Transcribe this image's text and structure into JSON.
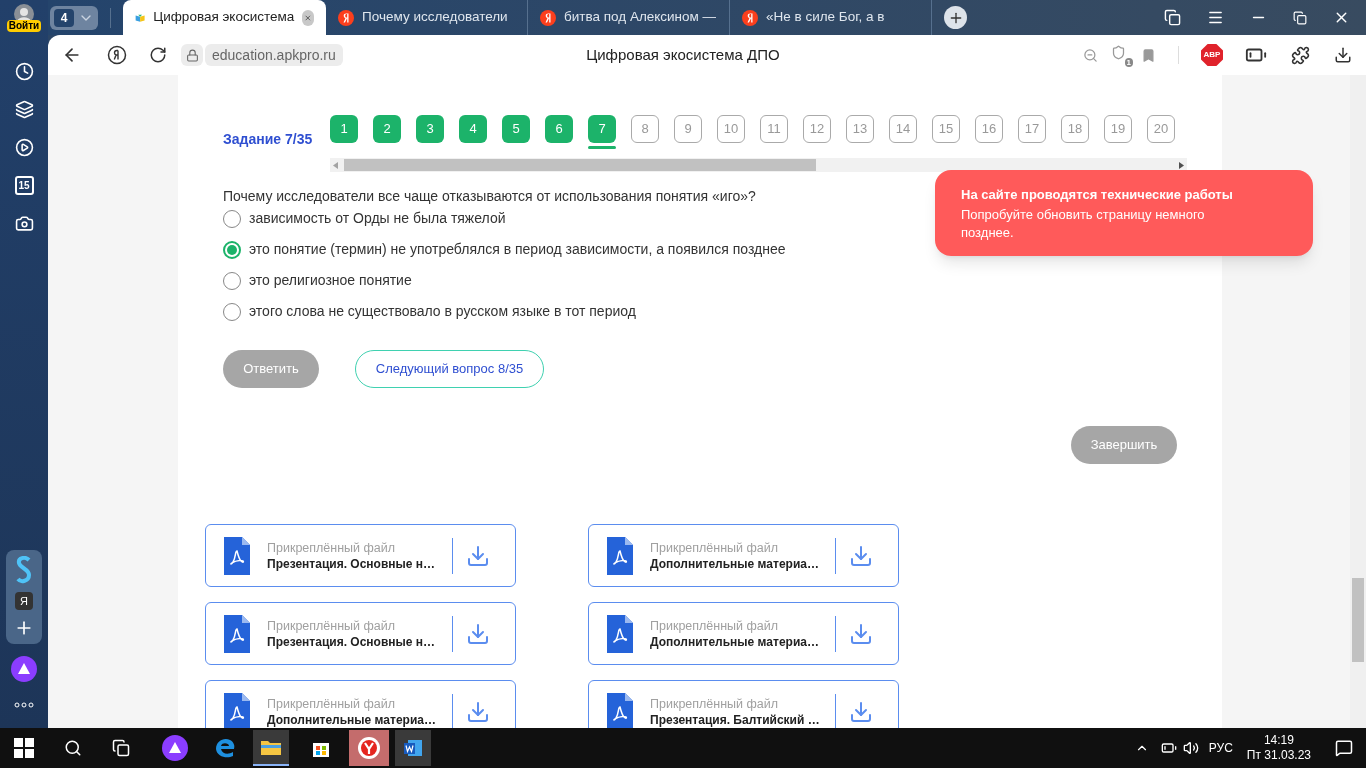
{
  "browser": {
    "profile_label": "Войти",
    "tab_count": "4",
    "tabs": [
      {
        "title": "Цифровая экосистема",
        "kind": "site",
        "selected": true
      },
      {
        "title": "Почему исследователи",
        "kind": "yandex",
        "selected": false
      },
      {
        "title": "битва под Алексином —",
        "kind": "yandex",
        "selected": false
      },
      {
        "title": "«Не в силе Бог, а в",
        "kind": "yandex",
        "selected": false
      }
    ],
    "address": "education.apkpro.ru",
    "page_title": "Цифровая экосистема ДПО",
    "shield_badge": "1",
    "adblock_label": "ABP"
  },
  "sidebar": {
    "calendar_day": "15",
    "panel_letter": "Я"
  },
  "quiz": {
    "task_label": "Задание 7/35",
    "pages": [
      {
        "label": "1",
        "done": true,
        "selected": false
      },
      {
        "label": "2",
        "done": true,
        "selected": false
      },
      {
        "label": "3",
        "done": true,
        "selected": false
      },
      {
        "label": "4",
        "done": true,
        "selected": false
      },
      {
        "label": "5",
        "done": true,
        "selected": false
      },
      {
        "label": "6",
        "done": true,
        "selected": false
      },
      {
        "label": "7",
        "done": true,
        "selected": true
      },
      {
        "label": "8",
        "done": false,
        "selected": false
      },
      {
        "label": "9",
        "done": false,
        "selected": false
      },
      {
        "label": "10",
        "done": false,
        "selected": false
      },
      {
        "label": "11",
        "done": false,
        "selected": false
      },
      {
        "label": "12",
        "done": false,
        "selected": false
      },
      {
        "label": "13",
        "done": false,
        "selected": false
      },
      {
        "label": "14",
        "done": false,
        "selected": false
      },
      {
        "label": "15",
        "done": false,
        "selected": false
      },
      {
        "label": "16",
        "done": false,
        "selected": false
      },
      {
        "label": "17",
        "done": false,
        "selected": false
      },
      {
        "label": "18",
        "done": false,
        "selected": false
      },
      {
        "label": "19",
        "done": false,
        "selected": false
      },
      {
        "label": "20",
        "done": false,
        "selected": false
      }
    ],
    "question": "Почему исследователи все чаще отказываются от использования понятия «иго»?",
    "options": [
      {
        "text": "зависимость от Орды не была тяжелой",
        "selected": false
      },
      {
        "text": "это понятие (термин) не употреблялся в период зависимости, а появился позднее",
        "selected": true
      },
      {
        "text": "это религиозное понятие",
        "selected": false
      },
      {
        "text": "этого слова не существовало в русском языке в тот период",
        "selected": false
      }
    ],
    "answer_button": {
      "label": "Ответить",
      "disabled": true
    },
    "next_button": "Следующий вопрос 8/35",
    "finish_button": "Завершить"
  },
  "files": [
    {
      "caption": "Прикреплённый файл",
      "name": "Презентация. Основные н…"
    },
    {
      "caption": "Прикреплённый файл",
      "name": "Дополнительные материа…"
    },
    {
      "caption": "Прикреплённый файл",
      "name": "Презентация. Основные н…"
    },
    {
      "caption": "Прикреплённый файл",
      "name": "Дополнительные материа…"
    },
    {
      "caption": "Прикреплённый файл",
      "name": "Дополнительные материа…"
    },
    {
      "caption": "Прикреплённый файл",
      "name": "Презентация. Балтийский …"
    }
  ],
  "toast": {
    "title": "На сайте проводятся технические работы",
    "message": "Попробуйте обновить страницу немного позднее."
  },
  "taskbar": {
    "language": "РУС",
    "time": "14:19",
    "date": "Пт 31.03.23"
  }
}
